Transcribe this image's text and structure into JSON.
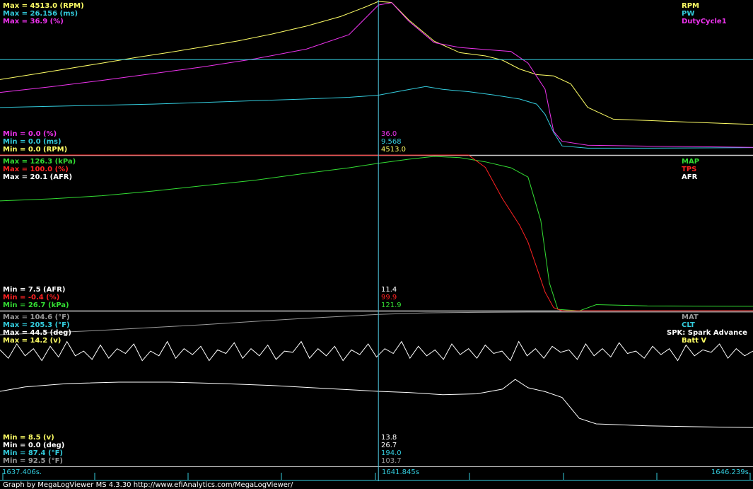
{
  "app": {
    "footer_text": "Graph by MegaLogViewer MS 4.3.30 http://www.efiAnalytics.com/MegaLogViewer/"
  },
  "colors": {
    "background": "#000000",
    "cursor": "#4fc9e0",
    "separator": "#cccccc",
    "yellow": "#ffff66",
    "cyan": "#33ccdd",
    "magenta": "#ee33ee",
    "green": "#33dd33",
    "red": "#ff2222",
    "white": "#ffffff",
    "gray": "#999999"
  },
  "chart_data": {
    "type": "line",
    "cursor_time": 1641.845,
    "time_axis": {
      "start_label": "1637.406s.",
      "cursor_label": "1641.845s",
      "end_label": "1646.239s.",
      "range": [
        1637.406,
        1646.239
      ]
    },
    "panels": [
      {
        "id": "panel1",
        "channels": [
          {
            "key": "rpm",
            "name": "RPM",
            "color": "#ffff66",
            "max_label": "Max = 4513.0 (RPM)",
            "min_label": "Min = 0.0 (RPM)",
            "cursor_value": "4513.0",
            "range": [
              0,
              4513
            ],
            "values": [
              [
                1637.406,
                2130
              ],
              [
                1637.8,
                2290
              ],
              [
                1638.2,
                2460
              ],
              [
                1638.6,
                2630
              ],
              [
                1639.0,
                2800
              ],
              [
                1639.4,
                2960
              ],
              [
                1639.8,
                3130
              ],
              [
                1640.2,
                3310
              ],
              [
                1640.6,
                3520
              ],
              [
                1641.0,
                3760
              ],
              [
                1641.4,
                4050
              ],
              [
                1641.7,
                4350
              ],
              [
                1641.845,
                4513
              ],
              [
                1642.0,
                4480
              ],
              [
                1642.2,
                3950
              ],
              [
                1642.5,
                3300
              ],
              [
                1642.8,
                2950
              ],
              [
                1643.1,
                2850
              ],
              [
                1643.3,
                2720
              ],
              [
                1643.5,
                2450
              ],
              [
                1643.7,
                2280
              ],
              [
                1643.9,
                2240
              ],
              [
                1644.1,
                2000
              ],
              [
                1644.3,
                1280
              ],
              [
                1644.6,
                920
              ],
              [
                1645.0,
                880
              ],
              [
                1645.5,
                830
              ],
              [
                1646.0,
                780
              ],
              [
                1646.239,
                760
              ]
            ]
          },
          {
            "key": "pw",
            "name": "PW",
            "color": "#33ccdd",
            "max_label": "Max = 26.156 (ms)",
            "min_label": "Min = 0.0 (ms)",
            "cursor_value": "9.568",
            "range": [
              0,
              26.156
            ],
            "values": [
              [
                1637.406,
                7.4
              ],
              [
                1638.0,
                7.6
              ],
              [
                1638.6,
                7.8
              ],
              [
                1639.2,
                8.0
              ],
              [
                1639.8,
                8.3
              ],
              [
                1640.4,
                8.6
              ],
              [
                1641.0,
                8.9
              ],
              [
                1641.5,
                9.2
              ],
              [
                1641.845,
                9.568
              ],
              [
                1642.1,
                10.3
              ],
              [
                1642.4,
                11.1
              ],
              [
                1642.6,
                10.6
              ],
              [
                1642.9,
                10.2
              ],
              [
                1643.2,
                9.6
              ],
              [
                1643.5,
                8.9
              ],
              [
                1643.7,
                8.0
              ],
              [
                1643.8,
                6.2
              ],
              [
                1643.9,
                3.0
              ],
              [
                1644.0,
                0.6
              ],
              [
                1644.3,
                0.2
              ],
              [
                1645.0,
                0.2
              ],
              [
                1646.239,
                0.3
              ]
            ]
          },
          {
            "key": "dutycycle1",
            "name": "DutyCycle1",
            "color": "#ee33ee",
            "max_label": "Max = 36.9 (%)",
            "min_label": "Min = 0.0 (%)",
            "cursor_value": "36.0",
            "range": [
              0,
              36.9
            ],
            "values": [
              [
                1637.406,
                14.2
              ],
              [
                1638.0,
                15.6
              ],
              [
                1638.6,
                17.2
              ],
              [
                1639.2,
                18.9
              ],
              [
                1639.8,
                20.6
              ],
              [
                1640.4,
                22.6
              ],
              [
                1641.0,
                25.0
              ],
              [
                1641.5,
                28.6
              ],
              [
                1641.845,
                36.0
              ],
              [
                1642.0,
                36.6
              ],
              [
                1642.2,
                32.0
              ],
              [
                1642.5,
                26.6
              ],
              [
                1642.8,
                25.4
              ],
              [
                1643.1,
                24.9
              ],
              [
                1643.4,
                24.4
              ],
              [
                1643.6,
                21.5
              ],
              [
                1643.8,
                15.0
              ],
              [
                1643.9,
                4.5
              ],
              [
                1644.0,
                2.0
              ],
              [
                1644.3,
                1.0
              ],
              [
                1645.0,
                0.8
              ],
              [
                1646.239,
                0.5
              ]
            ]
          }
        ]
      },
      {
        "id": "panel2",
        "channels": [
          {
            "key": "map",
            "name": "MAP",
            "color": "#33dd33",
            "max_label": "Max = 126.3 (kPa)",
            "min_label": "Min = 26.7 (kPa)",
            "cursor_value": "121.9",
            "range": [
              26.7,
              126.3
            ],
            "values": [
              [
                1637.406,
                97.7
              ],
              [
                1638.0,
                99.0
              ],
              [
                1638.6,
                101.0
              ],
              [
                1639.2,
                104.0
              ],
              [
                1639.8,
                107.5
              ],
              [
                1640.4,
                111.0
              ],
              [
                1641.0,
                115.5
              ],
              [
                1641.5,
                119.0
              ],
              [
                1641.845,
                121.9
              ],
              [
                1642.2,
                124.5
              ],
              [
                1642.5,
                126.3
              ],
              [
                1642.8,
                125.5
              ],
              [
                1643.1,
                122.8
              ],
              [
                1643.4,
                119.0
              ],
              [
                1643.6,
                113.0
              ],
              [
                1643.75,
                85.0
              ],
              [
                1643.85,
                45.0
              ],
              [
                1643.95,
                28.0
              ],
              [
                1644.2,
                27.0
              ],
              [
                1644.4,
                31.0
              ],
              [
                1645.0,
                30.2
              ],
              [
                1646.239,
                30.0
              ]
            ]
          },
          {
            "key": "tps",
            "name": "TPS",
            "color": "#ff2222",
            "max_label": "Max = 100.0 (%)",
            "min_label": "Min = -0.4 (%)",
            "cursor_value": "99.9",
            "range": [
              -0.4,
              100
            ],
            "values": [
              [
                1637.406,
                100
              ],
              [
                1641.845,
                99.9
              ],
              [
                1642.9,
                100
              ],
              [
                1643.1,
                92.0
              ],
              [
                1643.3,
                72.0
              ],
              [
                1643.5,
                55.0
              ],
              [
                1643.6,
                44.0
              ],
              [
                1643.7,
                28.0
              ],
              [
                1643.8,
                12.0
              ],
              [
                1643.9,
                2.0
              ],
              [
                1644.0,
                0.0
              ],
              [
                1646.239,
                0.0
              ]
            ]
          },
          {
            "key": "afr",
            "name": "AFR",
            "color": "#ffffff",
            "max_label": "Max = 20.1 (AFR)",
            "min_label": "Min = 7.5 (AFR)",
            "cursor_value": "11.4",
            "range": [
              7.5,
              20.1
            ],
            "values": [
              11.55,
              11.2,
              11.8,
              11.3,
              11.6,
              11.1,
              11.7,
              11.25,
              11.9,
              11.3,
              11.5,
              11.15,
              11.75,
              11.2,
              11.6,
              11.4,
              11.8,
              11.1,
              11.5,
              11.3,
              11.9,
              11.2,
              11.6,
              11.35,
              11.7,
              11.1,
              11.55,
              11.4,
              11.85,
              11.2,
              11.6,
              11.3,
              11.75,
              11.15,
              11.5,
              11.45,
              11.9,
              11.2,
              11.6,
              11.3,
              11.7,
              11.1,
              11.55,
              11.35,
              11.8,
              11.25,
              11.6,
              11.4,
              11.9,
              11.2,
              11.7,
              11.3,
              11.55,
              11.15,
              11.8,
              11.35,
              11.6,
              11.2,
              11.75,
              11.4,
              11.5,
              11.1,
              11.9,
              11.3,
              11.6,
              11.2,
              11.7,
              11.45,
              11.55,
              11.15,
              11.8,
              11.3,
              11.6,
              11.25,
              11.85,
              11.4,
              11.5,
              11.2,
              11.7,
              11.35,
              11.6,
              11.1,
              11.75,
              11.3,
              11.55,
              11.45,
              11.8,
              11.2,
              11.6,
              11.3,
              11.5
            ]
          }
        ]
      },
      {
        "id": "panel3",
        "channels": [
          {
            "key": "mat",
            "name": "MAT",
            "color": "#999999",
            "max_label": "Max = 104.6 (°F)",
            "min_label": "Min = 92.5 (°F)",
            "cursor_value": "103.7",
            "range": [
              92.5,
              104.6
            ],
            "values": [
              [
                1637.406,
                95.8
              ],
              [
                1638.0,
                96.6
              ],
              [
                1638.6,
                97.5
              ],
              [
                1639.2,
                98.6
              ],
              [
                1639.8,
                99.7
              ],
              [
                1640.4,
                101.0
              ],
              [
                1641.0,
                102.2
              ],
              [
                1641.845,
                103.7
              ],
              [
                1642.4,
                104.3
              ],
              [
                1643.0,
                104.5
              ],
              [
                1643.6,
                104.6
              ],
              [
                1644.2,
                104.6
              ],
              [
                1645.0,
                104.6
              ],
              [
                1646.239,
                104.6
              ]
            ]
          },
          {
            "key": "clt",
            "name": "CLT",
            "color": "#33ccdd",
            "max_label": "Max = 205.3 (°F)",
            "min_label": "Min = 87.4 (°F)",
            "cursor_value": "194.0",
            "range": [
              87.4,
              205.3
            ],
            "values": [
              194.0,
              194.0,
              194.0,
              194.0,
              194.0,
              194.0,
              194.0,
              194.0,
              194.0,
              194.0,
              194.0,
              194.0,
              194.0,
              194.0,
              194.0,
              194.0,
              194.0,
              194.0,
              194.0,
              194.0,
              194.0,
              194.0,
              194.0,
              194.0,
              194.0,
              194.0,
              194.0,
              194.0,
              194.0,
              194.0
            ]
          },
          {
            "key": "spk",
            "name": "SPK: Spark Advance",
            "color": "#ffffff",
            "max_label": "Max = 44.5 (deg)",
            "min_label": "Min = 0.0 (deg)",
            "cursor_value": "26.7",
            "range": [
              0,
              44.5
            ],
            "values": [
              [
                1637.406,
                26.7
              ],
              [
                1637.7,
                28.3
              ],
              [
                1638.2,
                29.5
              ],
              [
                1638.8,
                30.0
              ],
              [
                1639.4,
                30.0
              ],
              [
                1640.0,
                29.5
              ],
              [
                1640.6,
                28.8
              ],
              [
                1641.2,
                27.8
              ],
              [
                1641.845,
                26.7
              ],
              [
                1642.2,
                26.3
              ],
              [
                1642.6,
                25.5
              ],
              [
                1643.0,
                25.8
              ],
              [
                1643.3,
                27.5
              ],
              [
                1643.45,
                31.0
              ],
              [
                1643.6,
                28.0
              ],
              [
                1643.8,
                26.6
              ],
              [
                1644.0,
                24.5
              ],
              [
                1644.2,
                17.0
              ],
              [
                1644.4,
                15.0
              ],
              [
                1645.0,
                14.3
              ],
              [
                1645.5,
                14.0
              ],
              [
                1646.239,
                13.7
              ]
            ]
          },
          {
            "key": "battv",
            "name": "Batt V",
            "color": "#ffff66",
            "max_label": "Max = 14.2 (v)",
            "min_label": "Min = 8.5 (v)",
            "cursor_value": "13.8",
            "range": [
              8.5,
              14.2
            ],
            "values": [
              13.85,
              13.95,
              13.8,
              13.9,
              13.75,
              13.95,
              13.85,
              13.8,
              13.95,
              13.75,
              13.9,
              13.85,
              13.8,
              13.95,
              13.85,
              13.75,
              13.9,
              13.8,
              13.95,
              13.85,
              13.8,
              13.9,
              13.75,
              13.95,
              13.85,
              13.8,
              13.9,
              13.85,
              13.75,
              13.95,
              13.8,
              13.9,
              13.85,
              13.8,
              13.95,
              13.75,
              13.9,
              13.85,
              13.8,
              13.95
            ]
          }
        ]
      }
    ]
  }
}
